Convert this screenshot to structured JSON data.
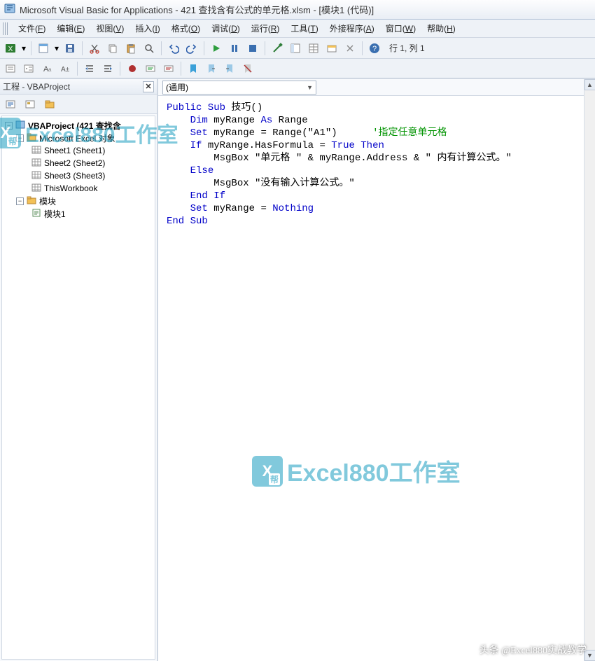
{
  "title": "Microsoft Visual Basic for Applications - 421 查找含有公式的单元格.xlsm - [模块1 (代码)]",
  "menu": [
    {
      "label": "文件",
      "hotkey": "F"
    },
    {
      "label": "编辑",
      "hotkey": "E"
    },
    {
      "label": "视图",
      "hotkey": "V"
    },
    {
      "label": "插入",
      "hotkey": "I"
    },
    {
      "label": "格式",
      "hotkey": "O"
    },
    {
      "label": "调试",
      "hotkey": "D"
    },
    {
      "label": "运行",
      "hotkey": "R"
    },
    {
      "label": "工具",
      "hotkey": "T"
    },
    {
      "label": "外接程序",
      "hotkey": "A"
    },
    {
      "label": "窗口",
      "hotkey": "W"
    },
    {
      "label": "帮助",
      "hotkey": "H"
    }
  ],
  "cursor_status": "行 1, 列 1",
  "project_panel": {
    "title": "工程 - VBAProject",
    "root": "VBAProject (421 查找含",
    "excel_objects": "Microsoft Excel 对象",
    "sheets": [
      {
        "label": "Sheet1 (Sheet1)"
      },
      {
        "label": "Sheet2 (Sheet2)"
      },
      {
        "label": "Sheet3 (Sheet3)"
      },
      {
        "label": "ThisWorkbook"
      }
    ],
    "modules_folder": "模块",
    "module_item": "模块1"
  },
  "code_combo": "(通用)",
  "code_lines": [
    {
      "indent": 0,
      "segments": [
        {
          "t": "Public Sub",
          "c": "kw"
        },
        {
          "t": " 技巧()",
          "c": ""
        }
      ]
    },
    {
      "indent": 1,
      "segments": [
        {
          "t": "Dim",
          "c": "kw"
        },
        {
          "t": " myRange ",
          "c": ""
        },
        {
          "t": "As",
          "c": "kw"
        },
        {
          "t": " Range",
          "c": ""
        }
      ]
    },
    {
      "indent": 1,
      "segments": [
        {
          "t": "Set",
          "c": "kw"
        },
        {
          "t": " myRange = Range(\"A1\")      ",
          "c": ""
        },
        {
          "t": "'指定任意单元格",
          "c": "cm"
        }
      ]
    },
    {
      "indent": 1,
      "segments": [
        {
          "t": "If",
          "c": "kw"
        },
        {
          "t": " myRange.HasFormula = ",
          "c": ""
        },
        {
          "t": "True Then",
          "c": "kw"
        }
      ]
    },
    {
      "indent": 2,
      "segments": [
        {
          "t": "MsgBox \"单元格 \" & myRange.Address & \" 内有计算公式。\"",
          "c": ""
        }
      ]
    },
    {
      "indent": 1,
      "segments": [
        {
          "t": "Else",
          "c": "kw"
        }
      ]
    },
    {
      "indent": 2,
      "segments": [
        {
          "t": "MsgBox \"没有输入计算公式。\"",
          "c": ""
        }
      ]
    },
    {
      "indent": 1,
      "segments": [
        {
          "t": "End If",
          "c": "kw"
        }
      ]
    },
    {
      "indent": 1,
      "segments": [
        {
          "t": "Set",
          "c": "kw"
        },
        {
          "t": " myRange = ",
          "c": ""
        },
        {
          "t": "Nothing",
          "c": "kw"
        }
      ]
    },
    {
      "indent": 0,
      "segments": [
        {
          "t": "End Sub",
          "c": "kw"
        }
      ]
    }
  ],
  "watermark": "Excel880工作室",
  "footer": "头条 @Excel880实战教学",
  "icons": {
    "excel": "x",
    "save": "s",
    "cut": "c",
    "copy": "cp",
    "paste": "p",
    "find": "f",
    "undo": "u",
    "redo": "r",
    "run": "▶",
    "break": "▮▮",
    "reset": "■",
    "design": "d",
    "project": "pj",
    "props": "pr",
    "objbrowse": "ob",
    "toolbox": "tb",
    "help": "?"
  }
}
